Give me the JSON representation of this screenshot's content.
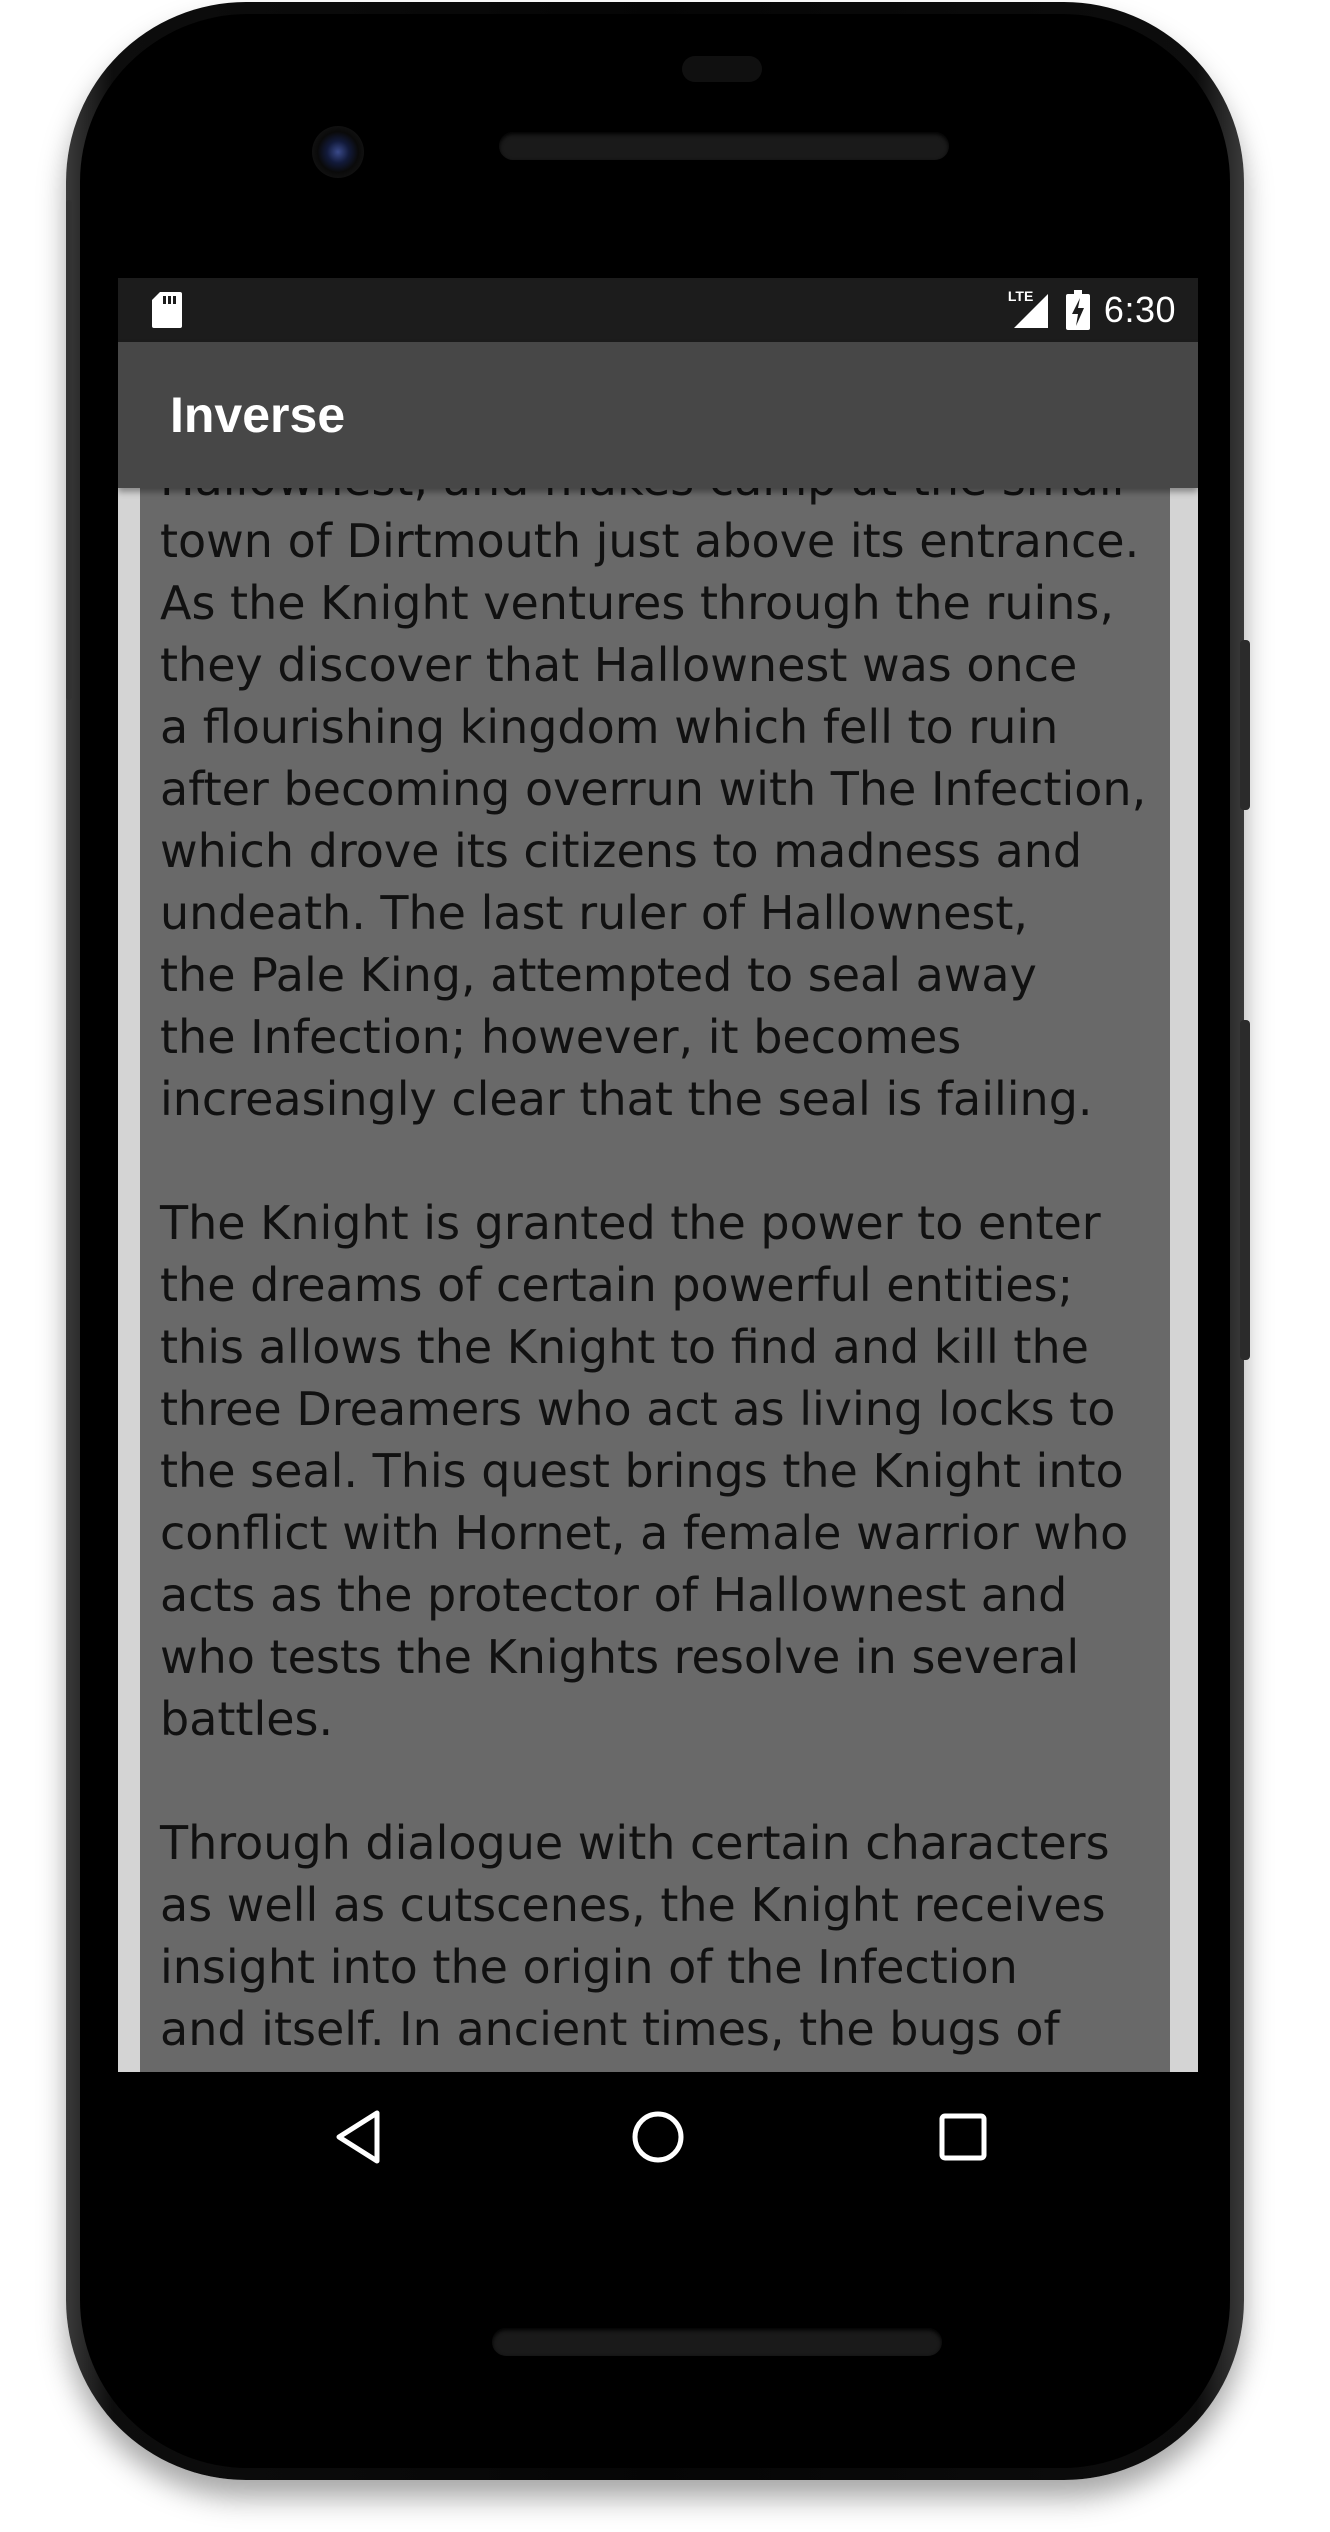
{
  "status_bar": {
    "network_label": "LTE",
    "time": "6:30",
    "icons": [
      "sd-card-icon",
      "lte-signal-icon",
      "battery-charging-icon"
    ]
  },
  "app_bar": {
    "title": "Inverse"
  },
  "article": {
    "paragraphs": [
      "Hallownest, and makes camp at the small\ntown of Dirtmouth just above its entrance.\nAs the Knight ventures through the ruins,\nthey discover that Hallownest was once\na flourishing kingdom which fell to ruin\nafter becoming overrun with The Infection,\nwhich drove its citizens to madness and\nundeath. The last ruler of Hallownest,\nthe Pale King, attempted to seal away\nthe Infection; however, it becomes\nincreasingly clear that the seal is failing.",
      "The Knight is granted the power to enter\nthe dreams of certain powerful entities;\nthis allows the Knight to find and kill the\nthree Dreamers who act as living locks to\nthe seal. This quest brings the Knight into\nconflict with Hornet, a female warrior who\nacts as the protector of Hallownest and\nwho tests the Knights resolve in several\nbattles.",
      "Through dialogue with certain characters\nas well as cutscenes, the Knight receives\ninsight into the origin of the Infection\nand itself. In ancient times, the bugs of"
    ]
  },
  "nav_bar": {
    "buttons": [
      "back-icon",
      "home-icon",
      "recents-icon"
    ]
  },
  "colors": {
    "status_bar": "#1c1c1c",
    "app_bar": "#474747",
    "content_panel": "#696969",
    "content_border": "#d4d4d4",
    "text": "#111111"
  }
}
